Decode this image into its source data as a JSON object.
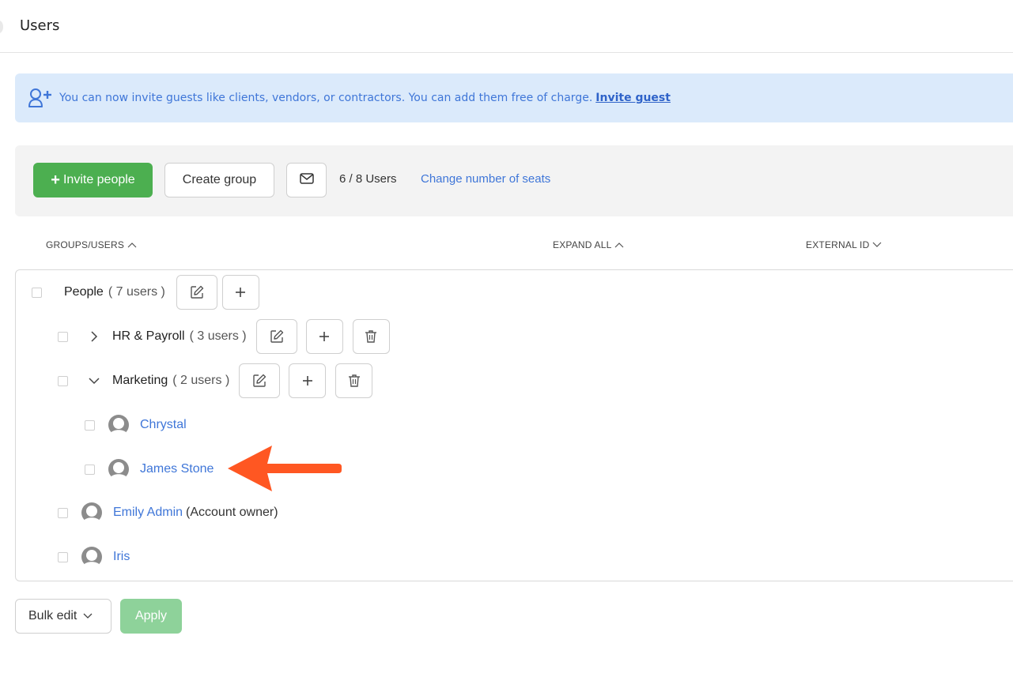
{
  "header": {
    "title": "Users"
  },
  "banner": {
    "text": "You can now invite guests like clients, vendors, or contractors. You can add them free of charge.",
    "link": "Invite guest"
  },
  "toolbar": {
    "invite_label": "Invite people",
    "create_group_label": "Create group",
    "seats": "6 / 8 Users",
    "change_seats_label": "Change number of seats"
  },
  "columns": {
    "groups_users": "GROUPS/USERS",
    "expand_all": "EXPAND ALL",
    "external_id": "EXTERNAL ID"
  },
  "tree": {
    "root": {
      "name": "People",
      "count": "( 7 users )"
    },
    "groups": [
      {
        "name": "HR & Payroll",
        "count": "( 3 users )",
        "expanded": false
      },
      {
        "name": "Marketing",
        "count": "( 2 users )",
        "expanded": true
      }
    ],
    "marketing_users": [
      {
        "name": "Chrystal"
      },
      {
        "name": "James Stone"
      }
    ],
    "root_users": [
      {
        "name": "Emily Admin",
        "note": "(Account owner)"
      },
      {
        "name": "Iris"
      }
    ]
  },
  "footer": {
    "bulk_edit_label": "Bulk edit",
    "apply_label": "Apply"
  },
  "colors": {
    "accent_green": "#4caf50",
    "link_blue": "#3f76d8",
    "banner_bg": "#dbeafb",
    "arrow": "#ff5722"
  }
}
